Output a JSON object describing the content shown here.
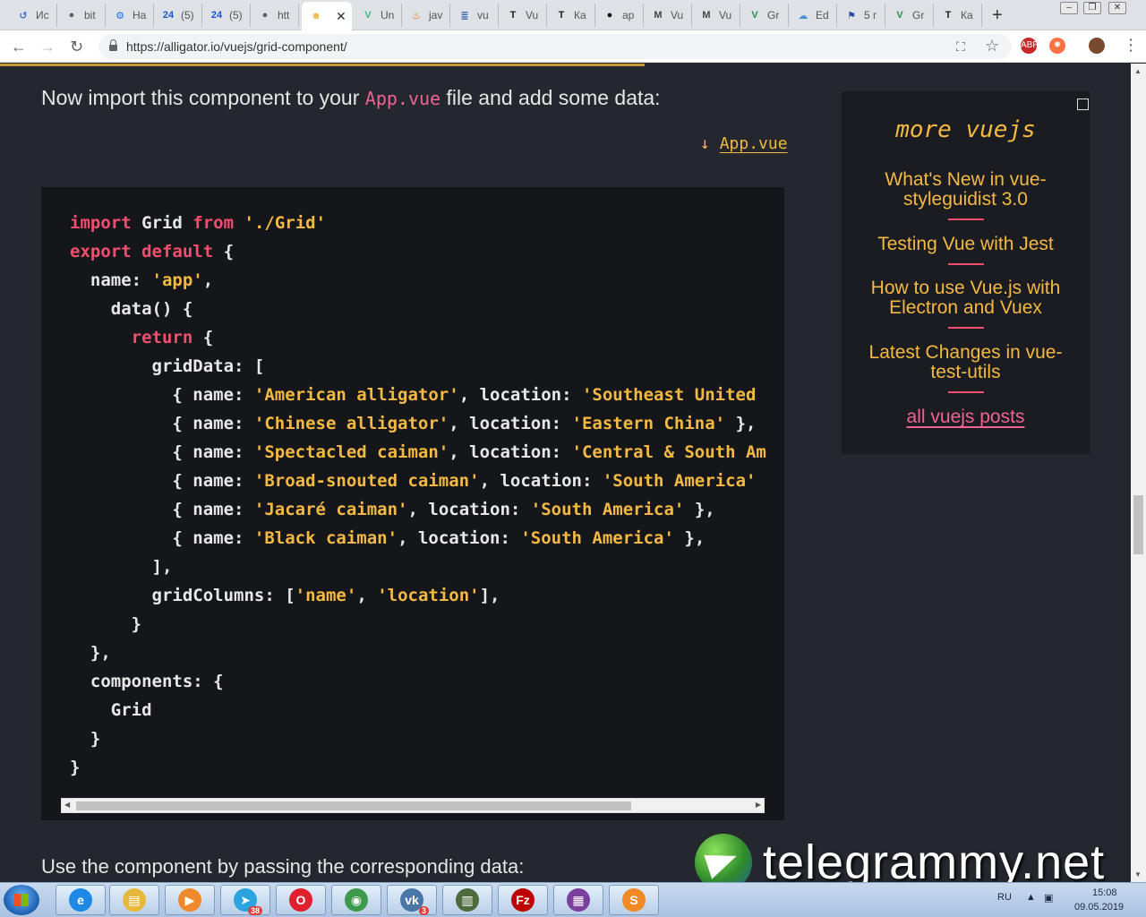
{
  "browser": {
    "tabs": [
      {
        "label": "Ис",
        "icon": "history-icon",
        "color": "#3b6fd1",
        "left": 0
      },
      {
        "label": "bit",
        "icon": "globe-icon",
        "color": "#5f6368",
        "left": 0
      },
      {
        "label": "На",
        "icon": "gear-icon",
        "color": "#1a73e8",
        "left": 0
      },
      {
        "label": "(5)",
        "icon": "24-icon",
        "color": "#1a56c6",
        "left": 0
      },
      {
        "label": "(5)",
        "icon": "24-icon",
        "color": "#1a56c6",
        "left": 0
      },
      {
        "label": "htt",
        "icon": "globe-icon",
        "color": "#5f6368",
        "left": 0
      },
      {
        "label": "",
        "icon": "alligator-icon",
        "color": "#f4b942",
        "active": true
      },
      {
        "label": "Un",
        "icon": "vue-icon",
        "color": "#41b883"
      },
      {
        "label": "jav",
        "icon": "java-icon",
        "color": "#e76f00"
      },
      {
        "label": "vu",
        "icon": "stackoverflow-icon",
        "color": "#2d5ca8"
      },
      {
        "label": "Vu",
        "icon": "t-icon",
        "color": "#222"
      },
      {
        "label": "Ка",
        "icon": "t-icon",
        "color": "#222"
      },
      {
        "label": "ap",
        "icon": "github-icon",
        "color": "#111"
      },
      {
        "label": "Vu",
        "icon": "mail-icon",
        "color": "#444"
      },
      {
        "label": "Vu",
        "icon": "mail-icon",
        "color": "#444"
      },
      {
        "label": "Gr",
        "icon": "vue-icon",
        "color": "#2e8b57"
      },
      {
        "label": "Ed",
        "icon": "cloud-icon",
        "color": "#4a90d9"
      },
      {
        "label": "5 г",
        "icon": "flag-icon",
        "color": "#2b4c9c"
      },
      {
        "label": "Gr",
        "icon": "vue-icon",
        "color": "#2e8b57"
      },
      {
        "label": "Ка",
        "icon": "t-icon",
        "color": "#222"
      }
    ],
    "url": "https://alligator.io/vuejs/grid-component/"
  },
  "article": {
    "intro_before": "Now import this component to your",
    "intro_code": "App.vue",
    "intro_after": "file and add some data:",
    "file_arrow": "↓",
    "file_name": "App.vue",
    "outro": "Use the component by passing the corresponding data:"
  },
  "code_lines": [
    [
      {
        "t": "import",
        "c": "kw"
      },
      {
        "t": " Grid "
      },
      {
        "t": "from",
        "c": "kw"
      },
      {
        "t": " "
      },
      {
        "t": "'./Grid'",
        "c": "str"
      }
    ],
    [
      {
        "t": "export default",
        "c": "kw"
      },
      {
        "t": " {"
      }
    ],
    [
      {
        "t": "  name: "
      },
      {
        "t": "'app'",
        "c": "str"
      },
      {
        "t": ","
      }
    ],
    [
      {
        "t": "    data() {"
      }
    ],
    [
      {
        "t": "      "
      },
      {
        "t": "return",
        "c": "kw"
      },
      {
        "t": " {"
      }
    ],
    [
      {
        "t": "        gridData: ["
      }
    ],
    [
      {
        "t": "          { name: "
      },
      {
        "t": "'American alligator'",
        "c": "str"
      },
      {
        "t": ", location: "
      },
      {
        "t": "'Southeast United States'",
        "c": "str"
      },
      {
        "t": " },"
      }
    ],
    [
      {
        "t": "          { name: "
      },
      {
        "t": "'Chinese alligator'",
        "c": "str"
      },
      {
        "t": ", location: "
      },
      {
        "t": "'Eastern China'",
        "c": "str"
      },
      {
        "t": " },"
      }
    ],
    [
      {
        "t": "          { name: "
      },
      {
        "t": "'Spectacled caiman'",
        "c": "str"
      },
      {
        "t": ", location: "
      },
      {
        "t": "'Central & South America'",
        "c": "str"
      },
      {
        "t": " },"
      }
    ],
    [
      {
        "t": "          { name: "
      },
      {
        "t": "'Broad-snouted caiman'",
        "c": "str"
      },
      {
        "t": ", location: "
      },
      {
        "t": "'South America'",
        "c": "str"
      },
      {
        "t": " },"
      }
    ],
    [
      {
        "t": "          { name: "
      },
      {
        "t": "'Jacaré caiman'",
        "c": "str"
      },
      {
        "t": ", location: "
      },
      {
        "t": "'South America'",
        "c": "str"
      },
      {
        "t": " },"
      }
    ],
    [
      {
        "t": "          { name: "
      },
      {
        "t": "'Black caiman'",
        "c": "str"
      },
      {
        "t": ", location: "
      },
      {
        "t": "'South America'",
        "c": "str"
      },
      {
        "t": " },"
      }
    ],
    [
      {
        "t": "        ],"
      }
    ],
    [
      {
        "t": "        gridColumns: ["
      },
      {
        "t": "'name'",
        "c": "str"
      },
      {
        "t": ", "
      },
      {
        "t": "'location'",
        "c": "str"
      },
      {
        "t": "],"
      }
    ],
    [
      {
        "t": "      }"
      }
    ],
    [
      {
        "t": "  },"
      }
    ],
    [
      {
        "t": "  components: {"
      }
    ],
    [
      {
        "t": "    Grid"
      }
    ],
    [
      {
        "t": "  }"
      }
    ],
    [
      {
        "t": "}"
      }
    ]
  ],
  "sidebar": {
    "title": "more vuejs",
    "items": [
      "What's New in vue-styleguidist 3.0",
      "Testing Vue with Jest",
      "How to use Vue.js with Electron and Vuex",
      "Latest Changes in vue-test-utils"
    ],
    "all_link": "all vuejs posts"
  },
  "watermark": {
    "text": "telegrammy.net"
  },
  "taskbar": {
    "apps": [
      {
        "name": "ie",
        "icon": "ie-icon",
        "color": "#1e88e5",
        "glyph": "e"
      },
      {
        "name": "explorer",
        "icon": "folder-icon",
        "color": "#e7b83a",
        "glyph": "▤"
      },
      {
        "name": "media",
        "icon": "media-player-icon",
        "color": "#ef8a2a",
        "glyph": "▶"
      },
      {
        "name": "telegram",
        "icon": "telegram-icon",
        "color": "#2aa3df",
        "glyph": "➤",
        "badge": "38"
      },
      {
        "name": "opera",
        "icon": "opera-icon",
        "color": "#e0202f",
        "glyph": "O"
      },
      {
        "name": "chrome",
        "icon": "chrome-icon",
        "color": "#3c9a4a",
        "glyph": "◉"
      },
      {
        "name": "vk",
        "icon": "vk-icon",
        "color": "#4a76a8",
        "glyph": "vk",
        "badge": "3"
      },
      {
        "name": "monitor",
        "icon": "monitor-icon",
        "color": "#4d6b3d",
        "glyph": "▥"
      },
      {
        "name": "filezilla",
        "icon": "filezilla-icon",
        "color": "#bf0000",
        "glyph": "Fz"
      },
      {
        "name": "winrar",
        "icon": "winrar-icon",
        "color": "#7b3fa0",
        "glyph": "▦"
      },
      {
        "name": "sublime",
        "icon": "sublime-icon",
        "color": "#f08a24",
        "glyph": "S"
      }
    ],
    "lang": "RU",
    "time": "15:08",
    "date": "09.05.2019"
  }
}
